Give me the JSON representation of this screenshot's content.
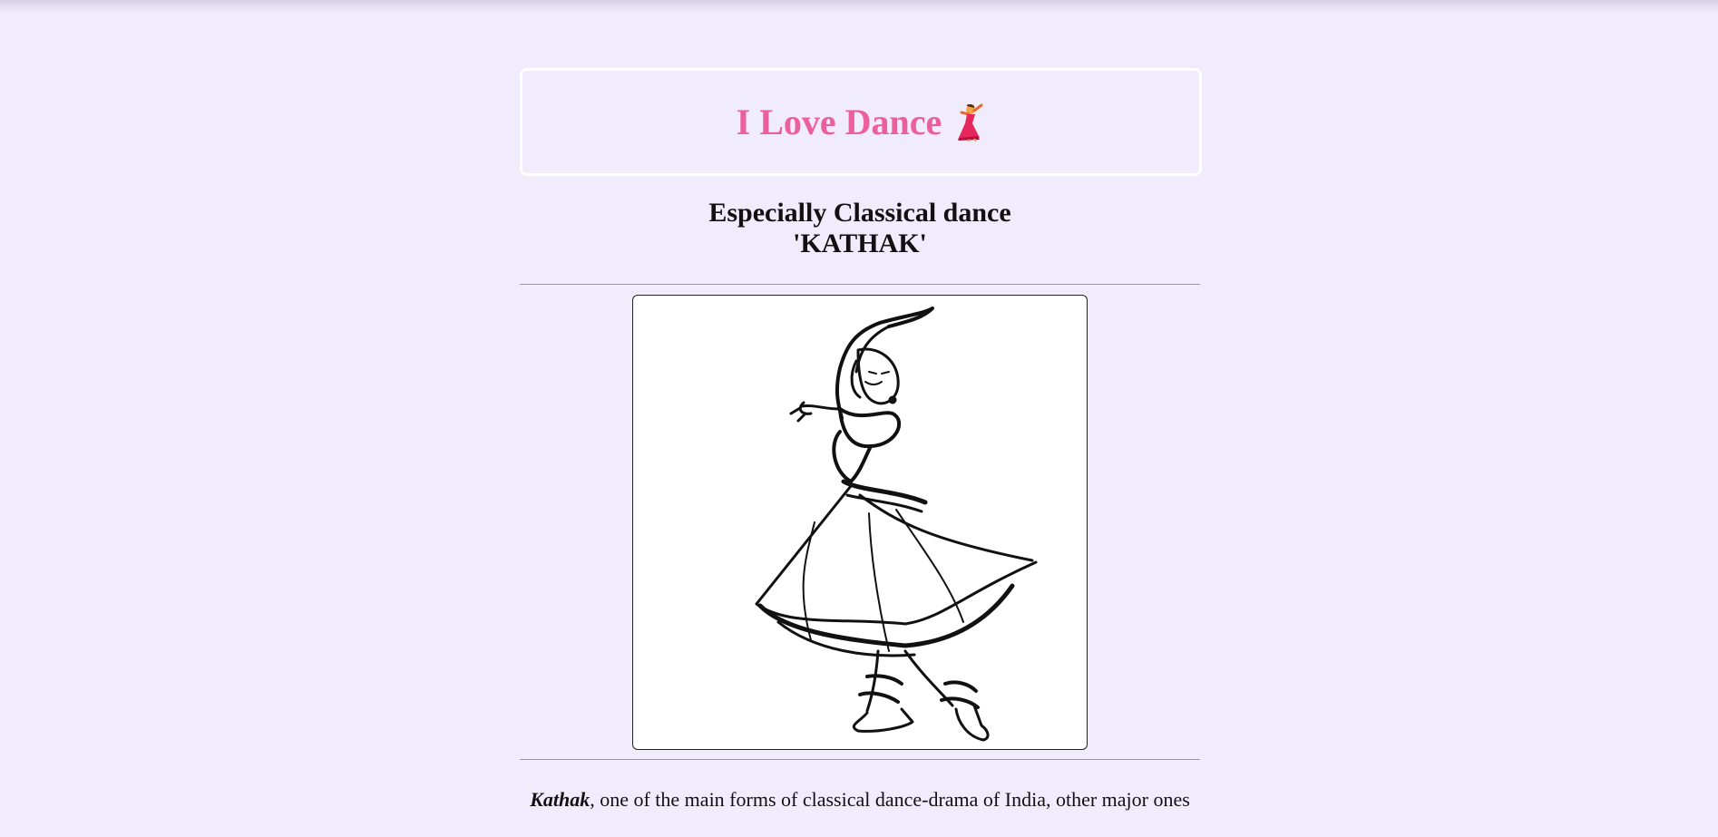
{
  "header": {
    "title": "I Love Dance",
    "title_emoji": "dancer-emoji"
  },
  "subtitle": {
    "line1": "Especially Classical dance",
    "line2": "'KATHAK'"
  },
  "image": {
    "alt": "Kathak dancer line drawing"
  },
  "intro": {
    "term": "Kathak",
    "text": ", one of the main forms of classical dance-drama of India, other major ones"
  },
  "colors": {
    "background": "#f0ecfc",
    "title": "#ec5f9d",
    "text": "#111111"
  }
}
